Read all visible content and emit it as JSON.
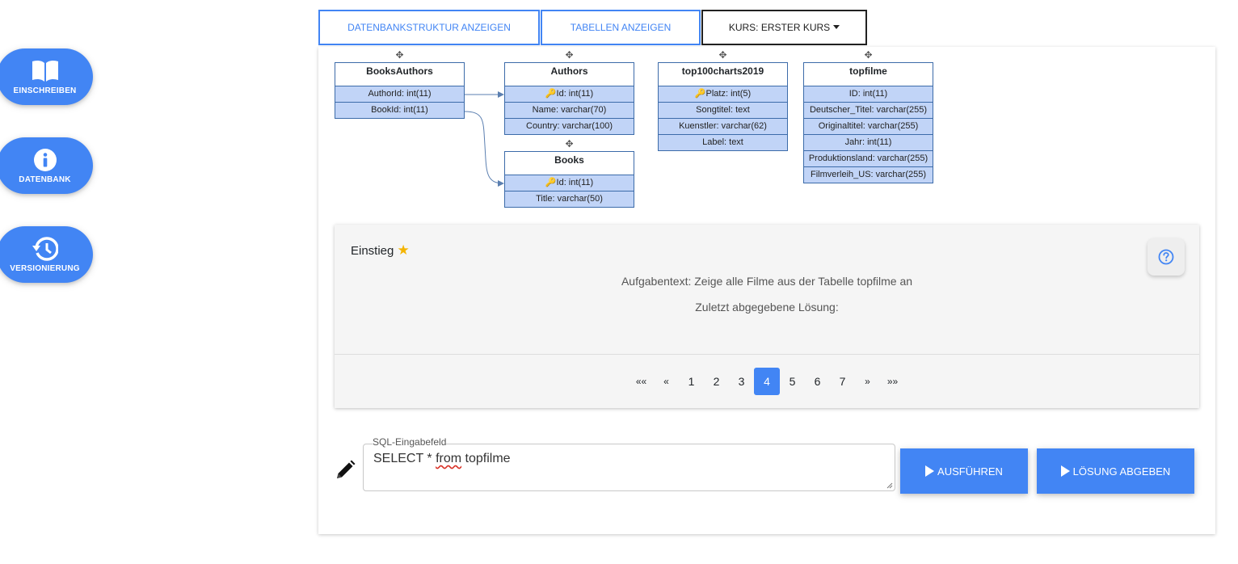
{
  "sidebar": {
    "items": [
      {
        "label": "EINSCHREIBEN",
        "icon": "book-icon"
      },
      {
        "label": "DATENBANK",
        "icon": "info-icon"
      },
      {
        "label": "VERSIONIERUNG",
        "icon": "history-icon"
      }
    ]
  },
  "tabs": {
    "structure": "DATENBANKSTRUKTUR ANZEIGEN",
    "tables": "TABELLEN ANZEIGEN",
    "course": "KURS: ERSTER KURS"
  },
  "schema": {
    "tables": [
      {
        "name": "BooksAuthors",
        "columns": [
          "AuthorId: int(11)",
          "BookId: int(11)"
        ]
      },
      {
        "name": "Authors",
        "columns": [
          "Id: int(11)",
          "Name: varchar(70)",
          "Country: varchar(100)"
        ]
      },
      {
        "name": "Books",
        "columns": [
          "Id: int(11)",
          "Title: varchar(50)"
        ]
      },
      {
        "name": "top100charts2019",
        "columns": [
          "Platz: int(5)",
          "Songtitel: text",
          "Kuenstler: varchar(62)",
          "Label: text"
        ]
      },
      {
        "name": "topfilme",
        "columns": [
          "ID: int(11)",
          "Deutscher_Titel: varchar(255)",
          "Originaltitel: varchar(255)",
          "Jahr: int(11)",
          "Produktionsland: varchar(255)",
          "Filmverleih_US: varchar(255)"
        ]
      }
    ]
  },
  "task": {
    "level": "Einstieg",
    "text": "Aufgabentext: Zeige alle Filme aus der Tabelle topfilme an",
    "last_solution": "Zuletzt abgegebene Lösung:"
  },
  "pagination": {
    "first": "««",
    "prev": "«",
    "pages": [
      "1",
      "2",
      "3",
      "4",
      "5",
      "6",
      "7"
    ],
    "active": "4",
    "next": "»",
    "last": "»»"
  },
  "sql": {
    "label": "SQL-Eingabefeld",
    "value_before": "SELECT * ",
    "value_flagged": "from",
    "value_after": " topfilme"
  },
  "actions": {
    "run": "AUSFÜHREN",
    "submit": "LÖSUNG ABGEBEN"
  },
  "colors": {
    "primary": "#4285f4",
    "table_row": "#c1d4f7",
    "star": "#f4b400"
  }
}
